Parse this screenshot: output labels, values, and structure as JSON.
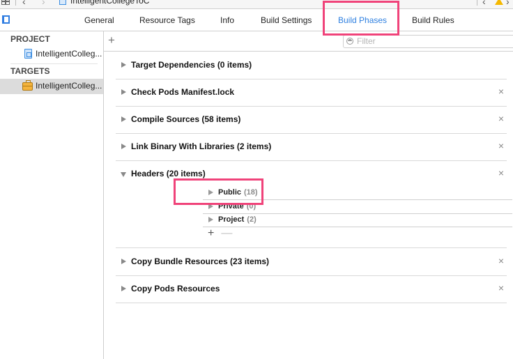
{
  "window": {
    "breadcrumb": "IntelligentCollegeToC"
  },
  "tabs": [
    {
      "label": "General",
      "active": false
    },
    {
      "label": "Resource Tags",
      "active": false
    },
    {
      "label": "Info",
      "active": false
    },
    {
      "label": "Build Settings",
      "active": false
    },
    {
      "label": "Build Phases",
      "active": true
    },
    {
      "label": "Build Rules",
      "active": false
    }
  ],
  "sidebar": {
    "project_header": "PROJECT",
    "project_item": "IntelligentColleg...",
    "targets_header": "TARGETS",
    "target_item": "IntelligentColleg..."
  },
  "toolbar": {
    "add_label": "+",
    "filter_placeholder": "Filter",
    "filter_value": ""
  },
  "phases": [
    {
      "title": "Target Dependencies (0 items)",
      "expanded": false,
      "deletable": false
    },
    {
      "title": "Check Pods Manifest.lock",
      "expanded": false,
      "deletable": true
    },
    {
      "title": "Compile Sources (58 items)",
      "expanded": false,
      "deletable": true
    },
    {
      "title": "Link Binary With Libraries (2 items)",
      "expanded": false,
      "deletable": true
    },
    {
      "title": "Headers (20 items)",
      "expanded": true,
      "deletable": true,
      "groups": [
        {
          "name": "Public",
          "count": "(18)"
        },
        {
          "name": "Private",
          "count": "(0)"
        },
        {
          "name": "Project",
          "count": "(2)"
        }
      ]
    },
    {
      "title": "Copy Bundle Resources (23 items)",
      "expanded": false,
      "deletable": true
    },
    {
      "title": "Copy Pods Resources",
      "expanded": false,
      "deletable": true
    }
  ],
  "icons": {
    "delete": "×",
    "add": "+",
    "remove": "—"
  },
  "colors": {
    "accent": "#2d7fe0",
    "highlight": "#f0437a",
    "warning": "#f5b800"
  }
}
